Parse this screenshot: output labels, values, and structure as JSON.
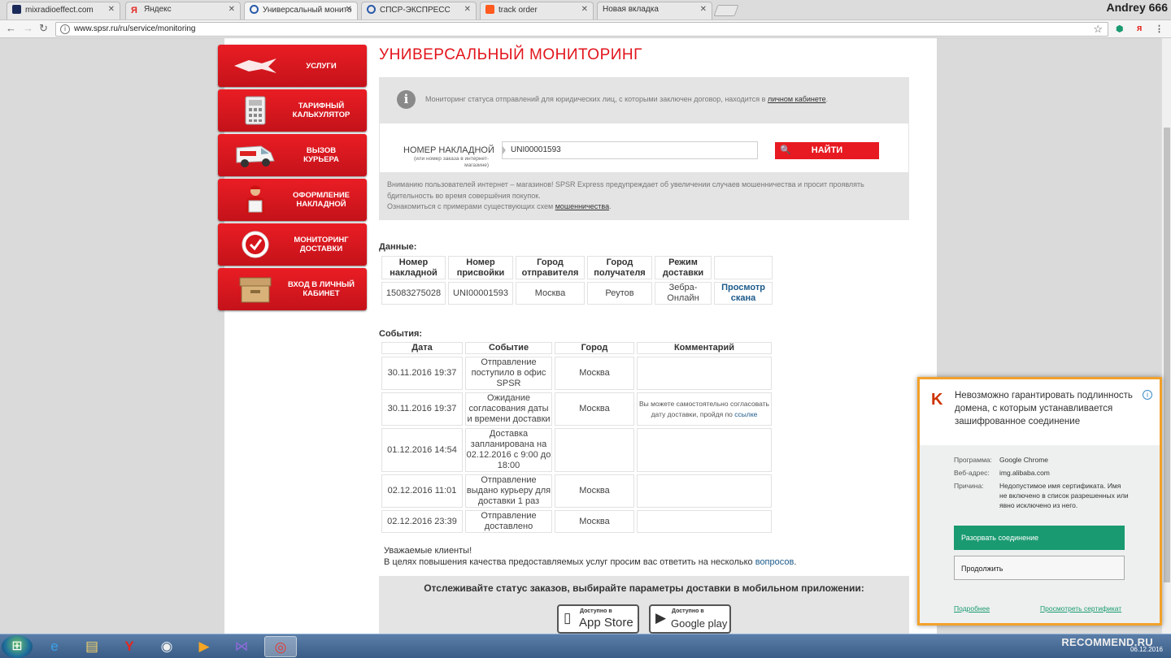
{
  "browser": {
    "tabs": [
      {
        "title": "mixradioeffect.com",
        "color": "#1a2a5a"
      },
      {
        "title": "Яндекс",
        "color": "#e52620"
      },
      {
        "title": "Универсальный монито",
        "color": "#2a5aa8"
      },
      {
        "title": "СПСР-ЭКСПРЕСС",
        "color": "#2a5aa8"
      },
      {
        "title": "track order",
        "color": "#ff5a1f"
      },
      {
        "title": "Новая вкладка",
        "color": ""
      }
    ],
    "user": "Andrey 666",
    "url": "www.spsr.ru/ru/service/monitoring"
  },
  "sidebar": {
    "items": [
      {
        "label": "УСЛУГИ",
        "icon": "services-icon"
      },
      {
        "label": "ТАРИФНЫЙ КАЛЬКУЛЯТОР",
        "icon": "calculator-icon"
      },
      {
        "label": "ВЫЗОВ КУРЬЕРА",
        "icon": "courier-van-icon"
      },
      {
        "label": "ОФОРМЛЕНИЕ НАКЛАДНОЙ",
        "icon": "courier-person-icon"
      },
      {
        "label": "МОНИТОРИНГ ДОСТАВКИ",
        "icon": "monitoring-icon"
      },
      {
        "label": "ВХОД В ЛИЧНЫЙ КАБИНЕТ",
        "icon": "cabinet-box-icon"
      }
    ]
  },
  "main": {
    "title": "УНИВЕРСАЛЬНЫЙ МОНИТОРИНГ",
    "info_text": "Мониторинг статуса отправлений для юридических лиц, с которыми заключен договор, находится в",
    "info_link": "личном кабинете",
    "info_tail": ".",
    "search": {
      "label": "НОМЕР НАКЛАДНОЙ",
      "hint": "(или номер заказа в интернет-магазине)",
      "value": "UNI00001593",
      "button": "НАЙТИ"
    },
    "warning_line1": "Вниманию пользователей интернет – магазинов! SPSR Express предупреждает об увеличении случаев мошенничества и просит проявлять бдительность во время совершёния покупок.",
    "warning_line2": "Ознакомиться с примерами существующих схем",
    "warning_link": "мошенничества",
    "warning_tail": "."
  },
  "data_table": {
    "caption": "Данные:",
    "headers": [
      "Номер накладной",
      "Номер присвойки",
      "Город отправителя",
      "Город получателя",
      "Режим доставки",
      ""
    ],
    "row": [
      "15083275028",
      "UNI00001593",
      "Москва",
      "Реутов",
      "Зебра-Онлайн"
    ],
    "link": "Просмотр скана"
  },
  "events_table": {
    "caption": "События:",
    "headers": [
      "Дата",
      "Событие",
      "Город",
      "Комментарий"
    ],
    "rows": [
      {
        "date": "30.11.2016 19:37",
        "event": "Отправление поступило в офис SPSR",
        "city": "Москва",
        "comment": "",
        "comment_link": ""
      },
      {
        "date": "30.11.2016 19:37",
        "event": "Ожидание согласования даты и времени доставки",
        "city": "Москва",
        "comment": "Вы можете самостоятельно согласовать дату доставки, пройдя по",
        "comment_link": "ссылке"
      },
      {
        "date": "01.12.2016 14:54",
        "event": "Доставка запланирована на 02.12.2016 с 9:00 до 18:00",
        "city": "",
        "comment": "",
        "comment_link": ""
      },
      {
        "date": "02.12.2016 11:01",
        "event": "Отправление выдано курьеру для доставки 1 раз",
        "city": "Москва",
        "comment": "",
        "comment_link": ""
      },
      {
        "date": "02.12.2016 23:39",
        "event": "Отправление доставлено",
        "city": "Москва",
        "comment": "",
        "comment_link": ""
      }
    ]
  },
  "footnote": {
    "line1": "Уважаемые клиенты!",
    "line2": "В целях повышения качества предоставляемых услуг просим вас ответить на несколько",
    "link": "вопросов",
    "tail": "."
  },
  "app_promo": {
    "title": "Отслеживайте статус заказов, выбирайте параметры доставки в мобильном приложении:",
    "appstore_small": "Доступно в",
    "appstore_big": "App Store",
    "gplay_small": "Доступно в",
    "gplay_big": "Google play"
  },
  "kaspersky": {
    "heading": "Невозможно гарантировать подлинность домена, с которым устанавливается зашифрованное соединение",
    "program_key": "Программа:",
    "program_val": "Google Chrome",
    "site_key": "Веб-адрес:",
    "site_val": "img.alibaba.com",
    "reason_key": "Причина:",
    "reason_val": "Недопустимое имя сертификата. Имя не включено в список разрешенных или явно исключено из него.",
    "btn_break": "Разорвать соединение",
    "btn_continue": "Продолжить",
    "link_more": "Подробнее",
    "link_cert": "Просмотреть сертификат"
  },
  "taskbar": {
    "date": "06.12.2016",
    "watermark": "RECOMMEND.RU"
  },
  "colors": {
    "brand_red": "#e2141b",
    "kaspersky_green": "#1a9a70"
  }
}
